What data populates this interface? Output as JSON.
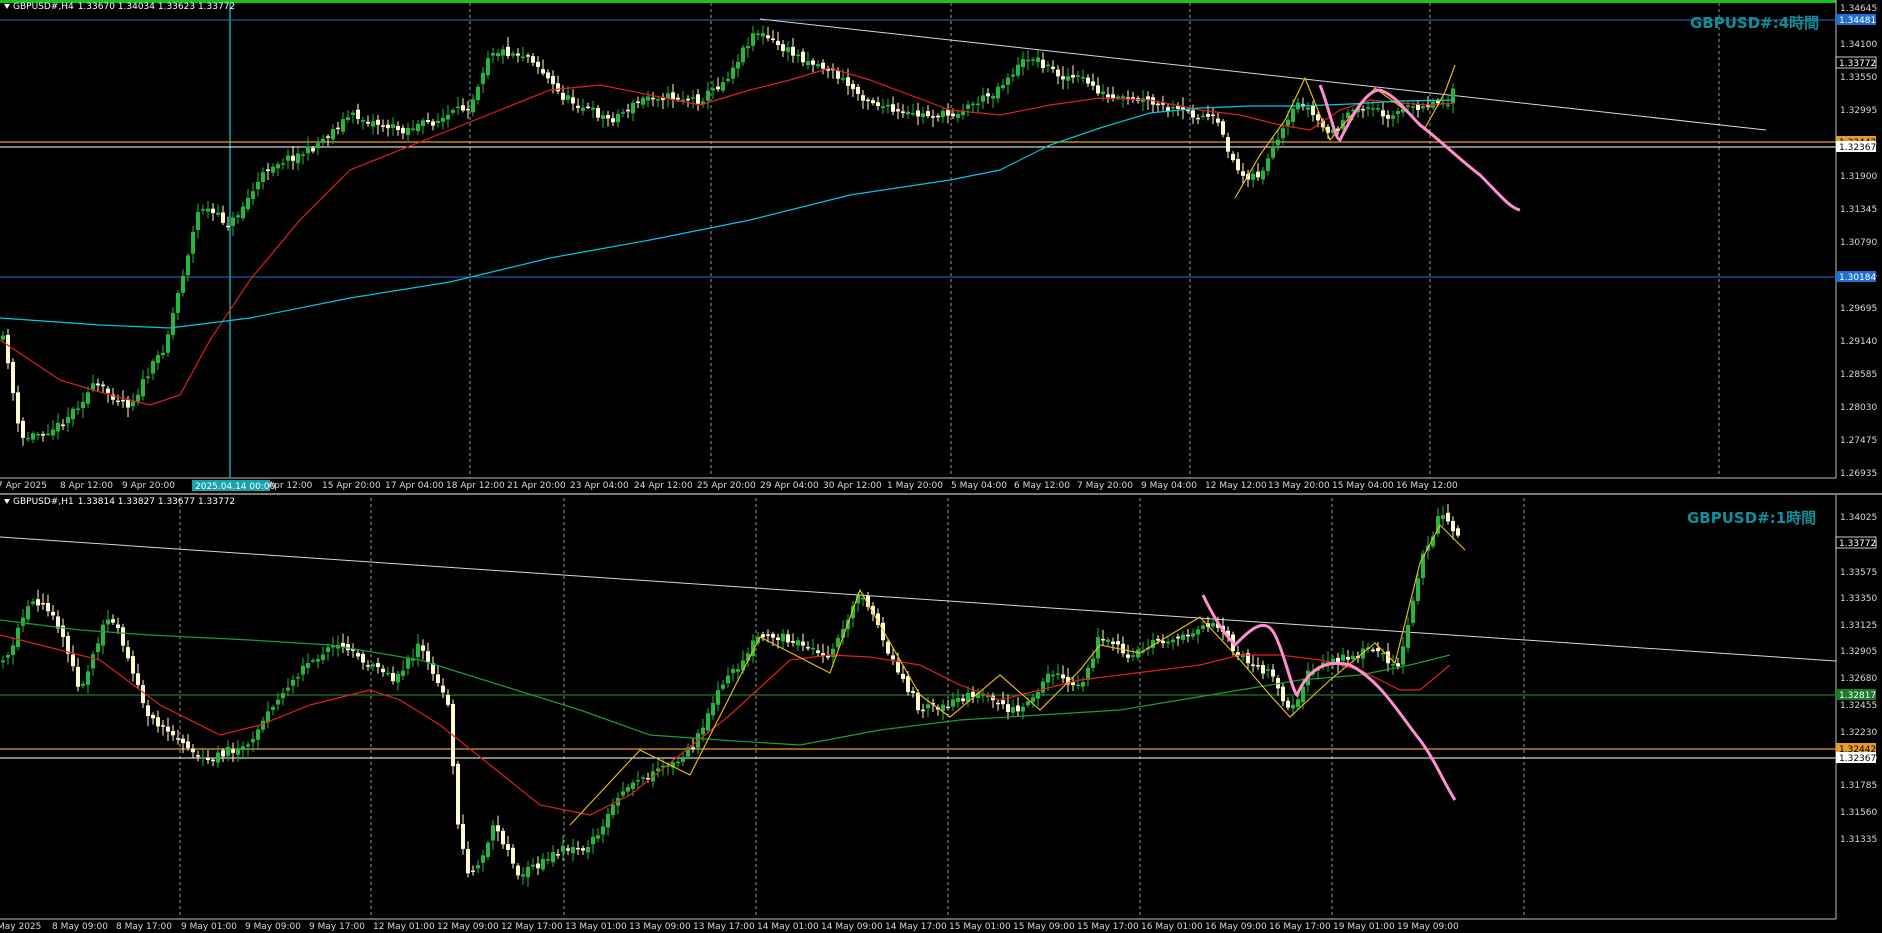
{
  "colors": {
    "background": "#000000",
    "bull": "#26b53d",
    "bear": "#fffbd1",
    "sma_red": "#e0201f",
    "sma_cyan": "#00c8e6",
    "sma_green": "#1e9a3a",
    "trendline": "#d8d8d8",
    "zigzag": "#f1c40f",
    "forecast_pink": "#ff8fd0",
    "level_blue": "#1f6fd1",
    "level_orange": "#e59c2a",
    "level_green": "#1c7a28",
    "level_white": "#ffffff",
    "label_tf": "#0e8f9a"
  },
  "top_chart": {
    "title": {
      "symbol": "GBPUSD#,H4",
      "ohlc": "1.33670 1.34034 1.33623 1.33772"
    },
    "timeframe_label": "GBPUSD#:4時間",
    "price_labels": [
      "1.34645",
      "1.34100",
      "1.33550",
      "1.32995",
      "1.32445",
      "1.31900",
      "1.31345",
      "1.30790",
      "1.30245",
      "1.29695",
      "1.29140",
      "1.28585",
      "1.28030",
      "1.27475",
      "1.26935"
    ],
    "level_tags": [
      {
        "text": "1.34481",
        "kind": "blue"
      },
      {
        "text": "1.33772",
        "kind": "price"
      },
      {
        "text": "1.32442",
        "kind": "orange"
      },
      {
        "text": "1.32367",
        "kind": "white"
      },
      {
        "text": "1.30184",
        "kind": "blue"
      }
    ],
    "crosshair_time": "2025.04.14 00:00",
    "time_labels": [
      "7 Apr 2025",
      "8 Apr 12:00",
      "9 Apr 20:00",
      "Apr 12:00",
      "15 Apr 20:00",
      "17 Apr 04:00",
      "18 Apr 12:00",
      "21 Apr 20:00",
      "23 Apr 04:00",
      "24 Apr 12:00",
      "25 Apr 20:00",
      "29 Apr 04:00",
      "30 Apr 12:00",
      "1 May 20:00",
      "5 May 04:00",
      "6 May 12:00",
      "7 May 20:00",
      "9 May 04:00",
      "12 May 12:00",
      "13 May 20:00",
      "15 May 04:00",
      "16 May 12:00"
    ]
  },
  "bottom_chart": {
    "title": {
      "symbol": "GBPUSD#,H1",
      "ohlc": "1.33814 1.33827 1.33677 1.33772"
    },
    "timeframe_label": "GBPUSD#:1時間",
    "price_labels": [
      "1.34025",
      "1.33800",
      "1.33575",
      "1.33350",
      "1.33125",
      "1.32905",
      "1.32680",
      "1.32455",
      "1.32230",
      "1.32010",
      "1.31785",
      "1.31560",
      "1.31335"
    ],
    "level_tags": [
      {
        "text": "1.33772",
        "kind": "price"
      },
      {
        "text": "1.32817",
        "kind": "green"
      },
      {
        "text": "1.32442",
        "kind": "orange"
      },
      {
        "text": "1.32367",
        "kind": "white"
      }
    ],
    "time_labels": [
      "May 2025",
      "8 May 09:00",
      "8 May 17:00",
      "9 May 01:00",
      "9 May 09:00",
      "9 May 17:00",
      "12 May 01:00",
      "12 May 09:00",
      "12 May 17:00",
      "13 May 01:00",
      "13 May 09:00",
      "13 May 17:00",
      "14 May 01:00",
      "14 May 09:00",
      "14 May 17:00",
      "15 May 01:00",
      "15 May 09:00",
      "15 May 17:00",
      "16 May 01:00",
      "16 May 09:00",
      "16 May 17:00",
      "19 May 01:00",
      "19 May 09:00"
    ]
  }
}
